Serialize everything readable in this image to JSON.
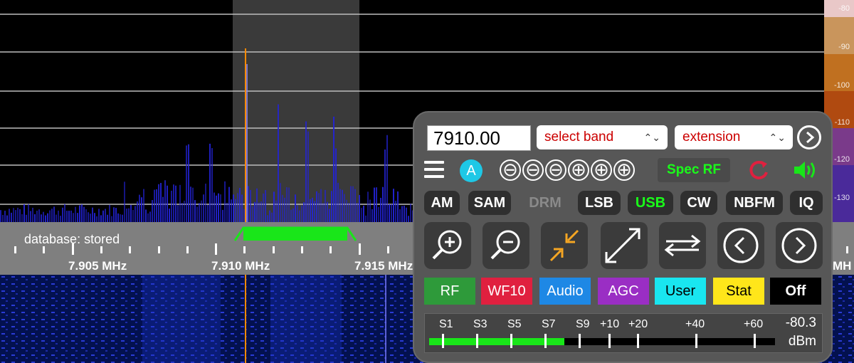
{
  "spectrum": {
    "db_scale": [
      "-80",
      "-90",
      "-100",
      "-110",
      "-120",
      "-130"
    ],
    "colors": {
      "passband_highlight": "#3a3a3a",
      "signal": "#1e1ee6",
      "carrier": "#ff7a00"
    }
  },
  "freq_scale": {
    "database_label": "database: stored",
    "labels": [
      "7.905 MHz",
      "7.910 MHz",
      "7.915 MHz",
      "MH"
    ],
    "passband_color": "#19e619"
  },
  "panel": {
    "frequency": "7910.00",
    "band_select": "select band",
    "extension_select": "extension",
    "a_button": "A",
    "zoom_glyphs": [
      "⊖",
      "⊖",
      "⊖",
      "⊕",
      "⊕",
      "⊕"
    ],
    "spec_rf": "Spec RF",
    "modes": [
      {
        "label": "AM",
        "state": "normal"
      },
      {
        "label": "SAM",
        "state": "normal"
      },
      {
        "label": "DRM",
        "state": "disabled"
      },
      {
        "label": "LSB",
        "state": "normal"
      },
      {
        "label": "USB",
        "state": "active"
      },
      {
        "label": "CW",
        "state": "normal"
      },
      {
        "label": "NBFM",
        "state": "normal"
      },
      {
        "label": "IQ",
        "state": "normal"
      }
    ],
    "tool_buttons": [
      "zoom-in-icon",
      "zoom-out-icon",
      "zoom-max-in-icon",
      "zoom-max-out-icon",
      "swap-icon",
      "step-left-icon",
      "step-right-icon"
    ],
    "tabs": [
      {
        "label": "RF",
        "bg": "#2e9a3a",
        "fg": "#ffffff"
      },
      {
        "label": "WF10",
        "bg": "#e0203f",
        "fg": "#ffffff"
      },
      {
        "label": "Audio",
        "bg": "#1e88e5",
        "fg": "#ffffff"
      },
      {
        "label": "AGC",
        "bg": "#9a2ec4",
        "fg": "#ffffff"
      },
      {
        "label": "User",
        "bg": "#19e6f0",
        "fg": "#000000"
      },
      {
        "label": "Stat",
        "bg": "#ffe61a",
        "fg": "#000000"
      },
      {
        "label": "Off",
        "bg": "#000000",
        "fg": "#ffffff"
      }
    ],
    "smeter": {
      "labels": [
        "S1",
        "S3",
        "S5",
        "S7",
        "S9",
        "+10",
        "+20",
        "+40",
        "+60"
      ],
      "value": "-80.3",
      "unit": "dBm",
      "level_fraction": 0.39
    }
  }
}
